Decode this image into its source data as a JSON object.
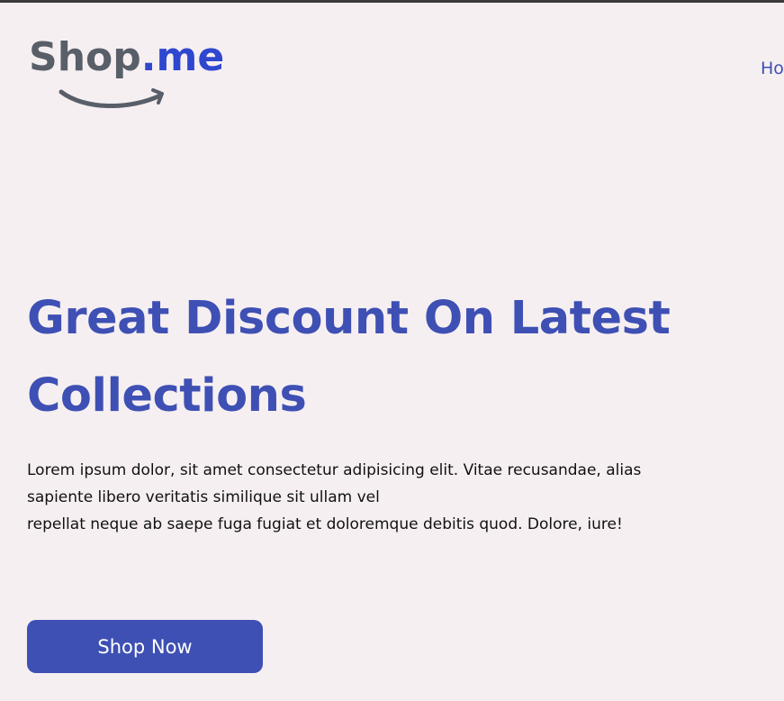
{
  "header": {
    "logo": {
      "text_main": "Shop",
      "text_accent": ".me",
      "smile_icon": "smile-arrow-icon",
      "main_color": "#595f69",
      "accent_color": "#2f47cf"
    },
    "nav": {
      "items": [
        {
          "label": "Ho"
        }
      ]
    }
  },
  "hero": {
    "title_line1": "Great Discount On Latest",
    "title_line2": "Collections",
    "description_line1": "Lorem ipsum dolor, sit amet consectetur adipisicing elit. Vitae recusandae, alias sapiente libero veritatis similique sit ullam vel",
    "description_line2": "repellat neque ab saepe fuga fugiat et doloremque debitis quod. Dolore, iure!",
    "button_label": "Shop Now"
  },
  "colors": {
    "background": "#f6eff1",
    "accent": "#3e50b4",
    "text": "#111111"
  }
}
